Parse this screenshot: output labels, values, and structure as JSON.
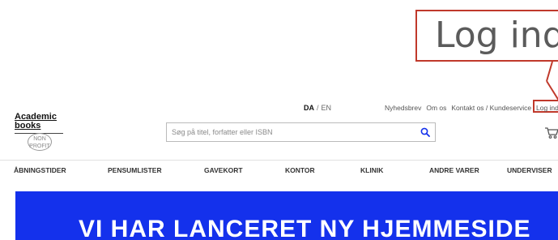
{
  "callout": {
    "zoom_text": "Log ind"
  },
  "logo": {
    "line1": "Academic",
    "line2": "books",
    "stamp": "NON PROFIT"
  },
  "language": {
    "active": "DA",
    "separator": "/",
    "other": "EN"
  },
  "top_links": {
    "newsletter": "Nyhedsbrev",
    "about": "Om os",
    "contact": "Kontakt os / Kundeservice",
    "login": "Log ind"
  },
  "search": {
    "placeholder": "Søg på titel, forfatter eller ISBN",
    "value": ""
  },
  "nav": {
    "items": [
      {
        "label": "ÅBNINGSTIDER"
      },
      {
        "label": "PENSUMLISTER"
      },
      {
        "label": "GAVEKORT"
      },
      {
        "label": "KONTOR"
      },
      {
        "label": "KLINIK"
      },
      {
        "label": "ANDRE VARER"
      },
      {
        "label": "UNDERVISER"
      }
    ]
  },
  "banner": {
    "headline": "VI HAR LANCERET NY HJEMMESIDE"
  },
  "colors": {
    "banner_bg": "#1431ec",
    "highlight": "#c0392b",
    "accent_blue": "#1431ec"
  },
  "icons": {
    "search": "search-icon",
    "cart": "cart-icon"
  }
}
